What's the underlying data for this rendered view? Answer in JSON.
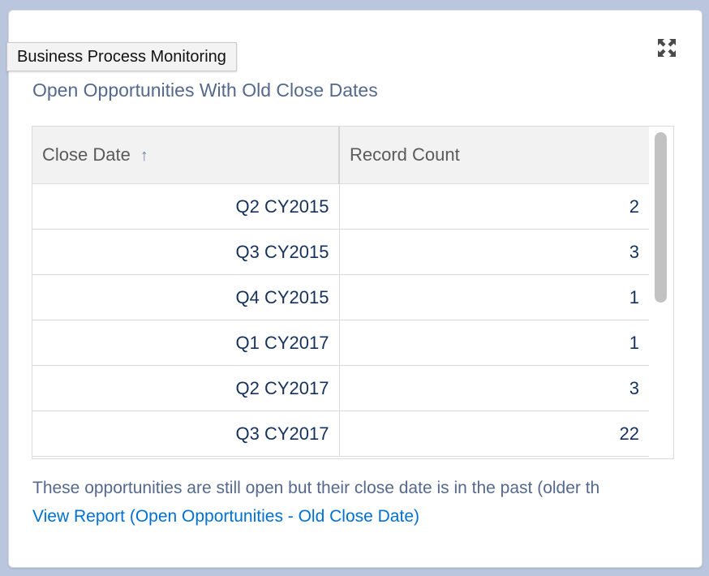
{
  "tooltip": {
    "text": "Business Process Monitoring"
  },
  "widget": {
    "title": "Open Opportunities With Old Close Dates",
    "expand_icon": "expand-icon"
  },
  "table": {
    "columns": [
      {
        "label": "Close Date",
        "sort": "ascending",
        "sort_icon": "arrow-up-icon"
      },
      {
        "label": "Record Count"
      }
    ],
    "rows": [
      {
        "close_date": "Q2 CY2015",
        "record_count": "2"
      },
      {
        "close_date": "Q3 CY2015",
        "record_count": "3"
      },
      {
        "close_date": "Q4 CY2015",
        "record_count": "1"
      },
      {
        "close_date": "Q1 CY2017",
        "record_count": "1"
      },
      {
        "close_date": "Q2 CY2017",
        "record_count": "3"
      },
      {
        "close_date": "Q3 CY2017",
        "record_count": "22"
      }
    ]
  },
  "footer": {
    "description": "These opportunities are still open but their close date is in the past (older th",
    "link_text": "View Report (Open Opportunities - Old Close Date)"
  },
  "colors": {
    "title": "#54698d",
    "cell_text": "#16325c",
    "link": "#0070d2",
    "header_bg": "#f3f2f2"
  }
}
